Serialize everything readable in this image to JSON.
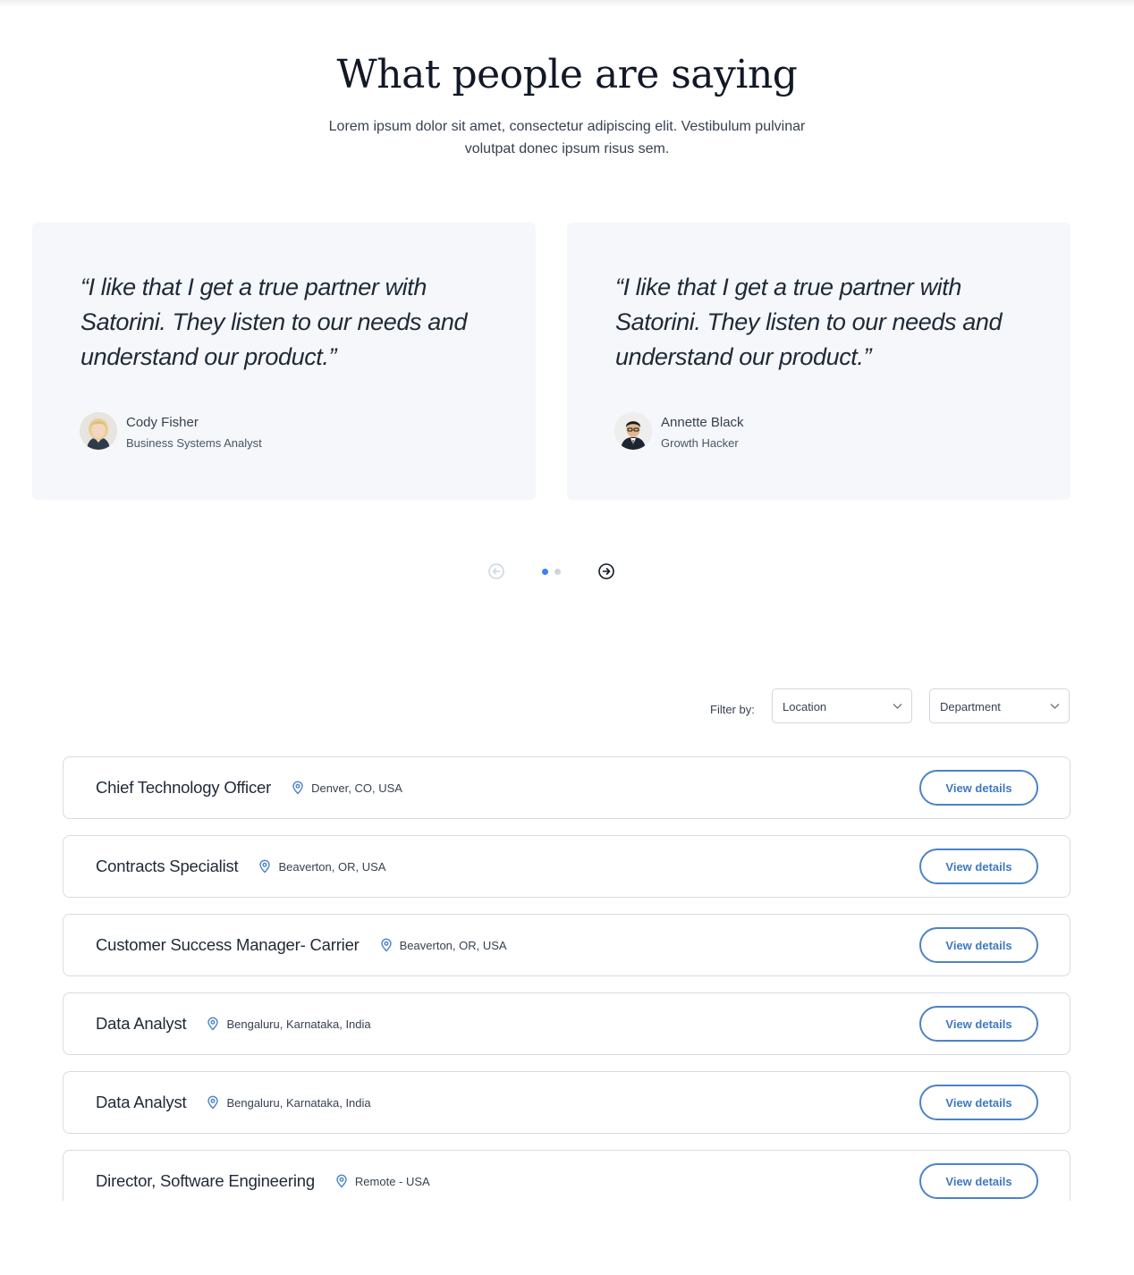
{
  "testimonials": {
    "heading": "What people are saying",
    "subtitle": "Lorem ipsum dolor sit amet, consectetur adipiscing elit. Vestibulum pulvinar volutpat donec ipsum risus sem.",
    "cards": [
      {
        "quote": "“I like that I get a true partner with Satorini. They listen to our needs and understand our product.”",
        "name": "Cody Fisher",
        "role": "Business Systems Analyst",
        "avatar_icon": "avatar-woman-blonde"
      },
      {
        "quote": "“I like that I get a true partner with Satorini. They listen to our needs and understand our product.”",
        "name": "Annette Black",
        "role": "Growth Hacker",
        "avatar_icon": "avatar-man-glasses"
      }
    ],
    "pager": {
      "prev_icon": "arrow-left-circle-icon",
      "next_icon": "arrow-right-circle-icon",
      "dots": 2,
      "active_dot": 1,
      "active_color": "#3b82f6",
      "inactive_color": "#d1d5db"
    }
  },
  "filters": {
    "label": "Filter by:",
    "location": "Location",
    "department": "Department"
  },
  "jobs": [
    {
      "title": "Chief Technology Officer",
      "location": "Denver, CO, USA",
      "action": "View details"
    },
    {
      "title": "Contracts Specialist",
      "location": "Beaverton, OR, USA",
      "action": "View details"
    },
    {
      "title": "Customer Success Manager- Carrier",
      "location": "Beaverton, OR, USA",
      "action": "View details"
    },
    {
      "title": "Data Analyst",
      "location": "Bengaluru, Karnataka, India",
      "action": "View details"
    },
    {
      "title": "Data Analyst",
      "location": "Bengaluru, Karnataka, India",
      "action": "View details"
    },
    {
      "title": "Director, Software Engineering",
      "location": "Remote - USA",
      "action": "View details"
    }
  ],
  "colors": {
    "accent": "#3f78c2",
    "card_bg": "#f5f7fa",
    "border": "#d6dbe2"
  }
}
